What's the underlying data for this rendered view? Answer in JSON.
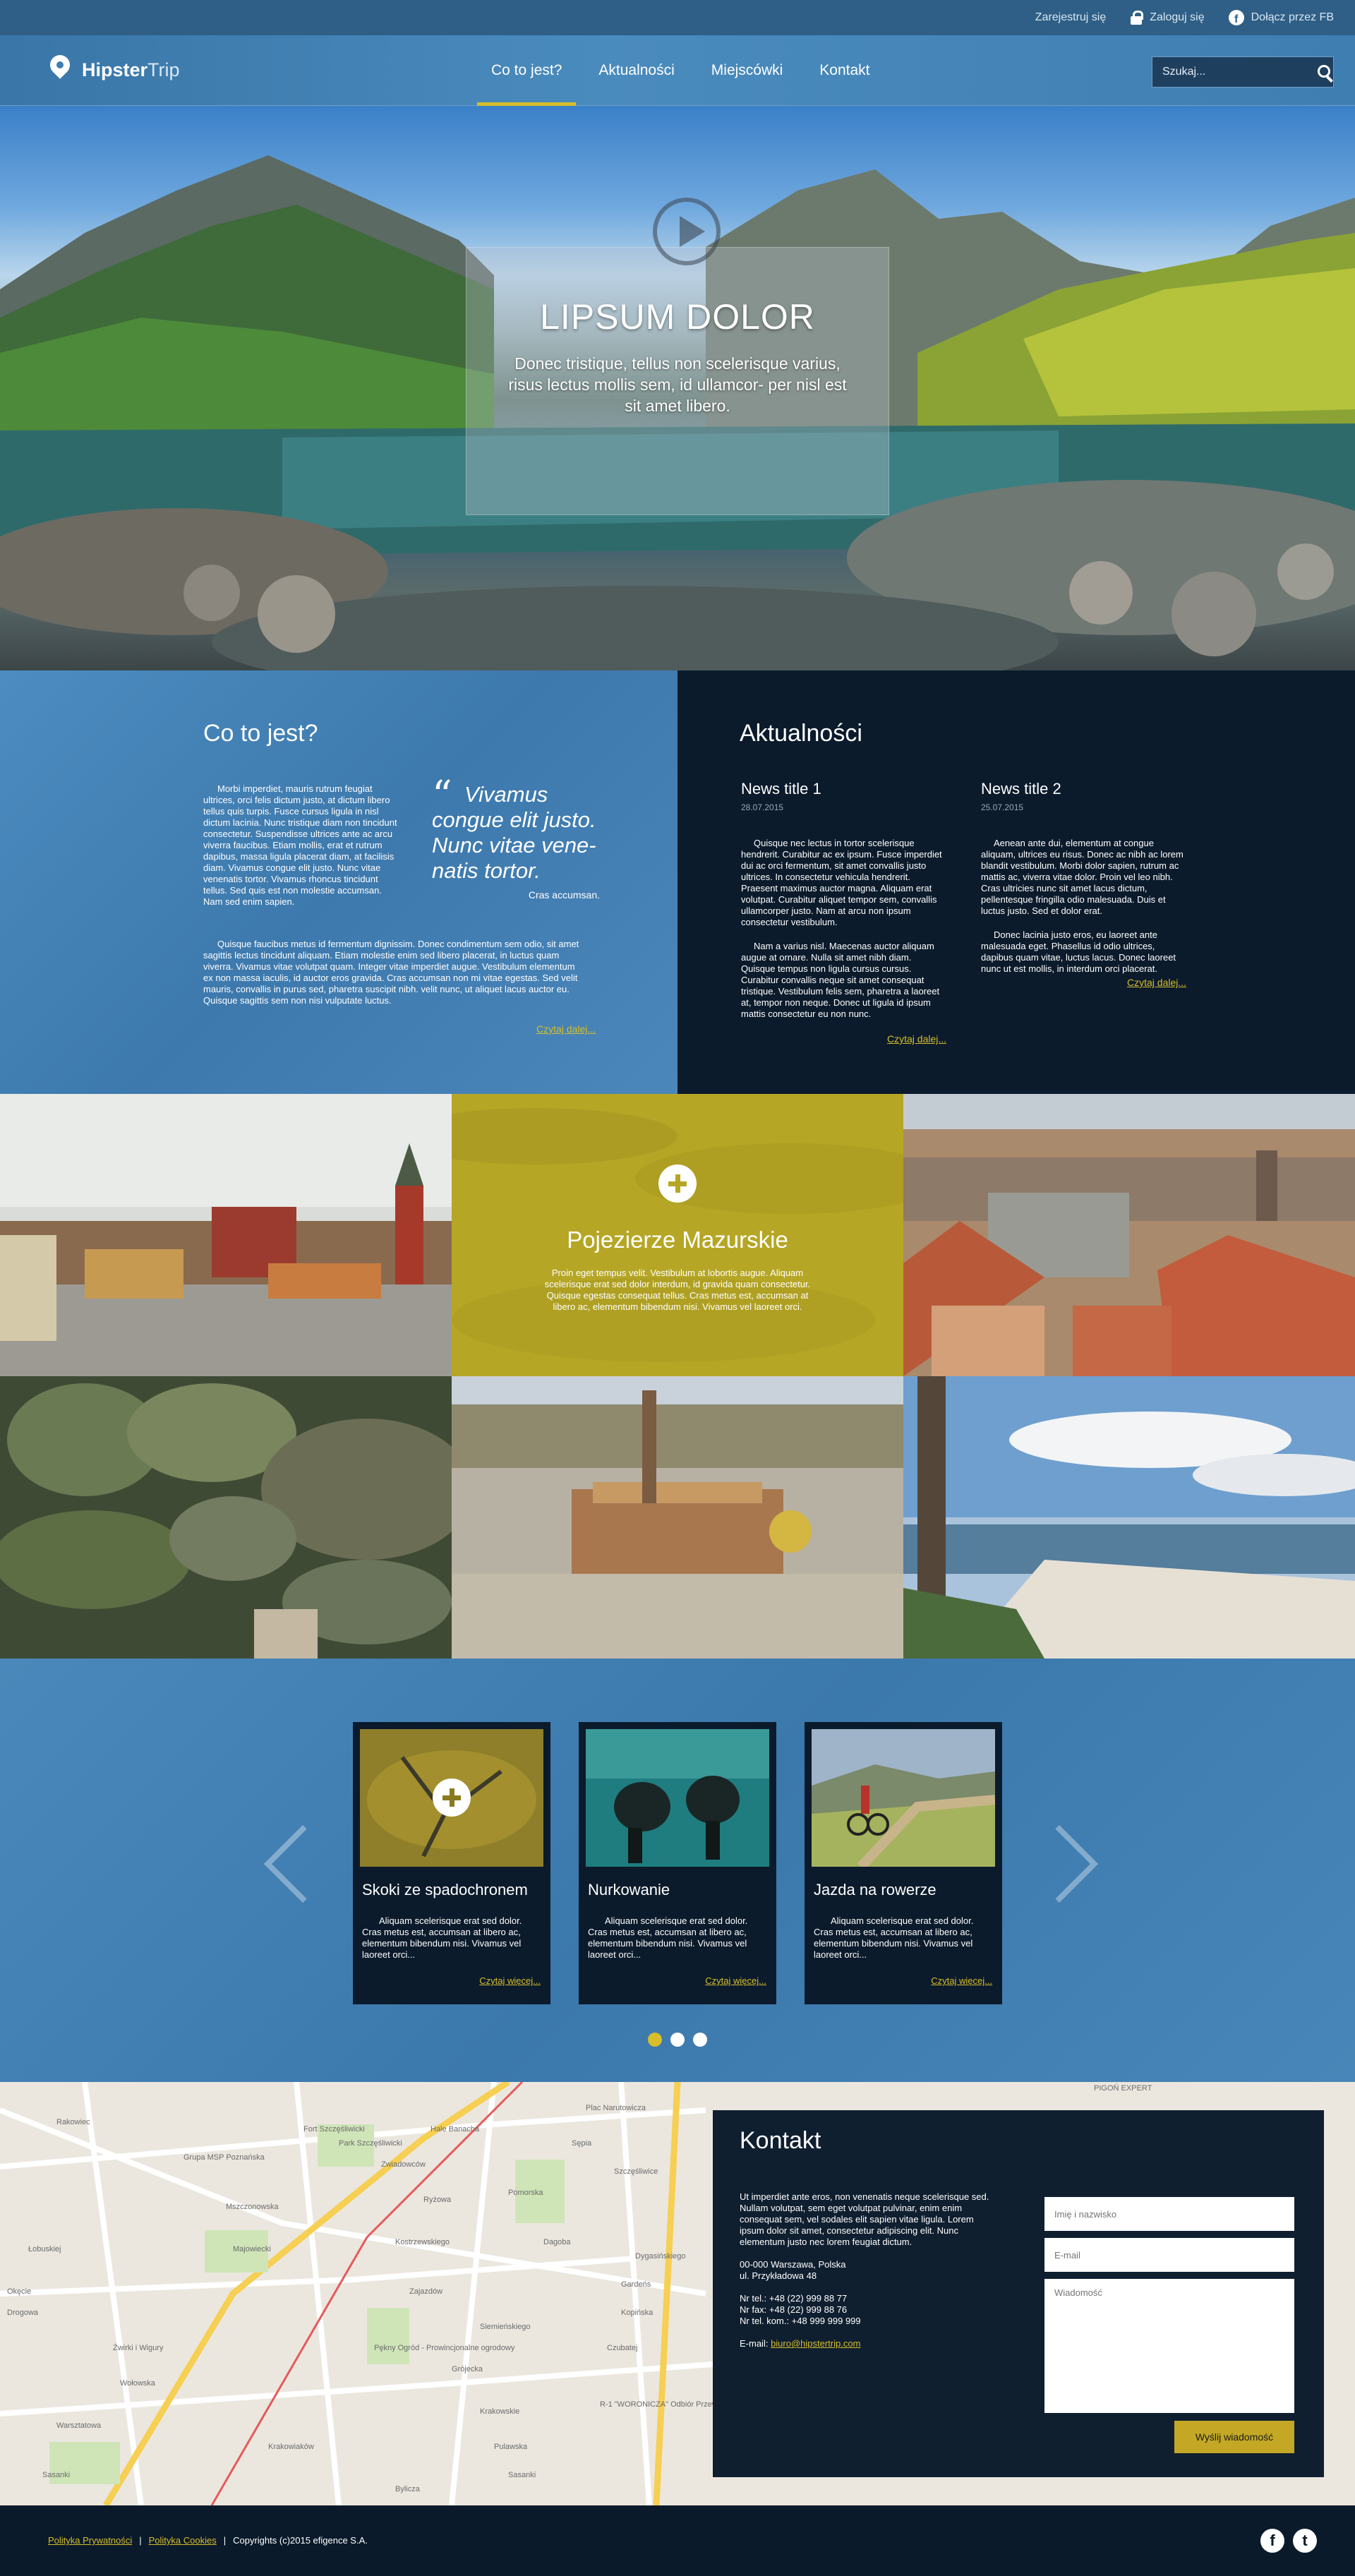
{
  "topbar": {
    "register": "Zarejestruj się",
    "login": "Zaloguj się",
    "facebook": "Dołącz przez FB",
    "login_icon": "lock-icon",
    "facebook_icon": "facebook-icon"
  },
  "header": {
    "logo_bold": "Hipster",
    "logo_light": "Trip",
    "nav": [
      "Co to jest?",
      "Aktualności",
      "Miejscówki",
      "Kontakt"
    ],
    "active_nav": "Co to jest?",
    "search_placeholder": "Szukaj..."
  },
  "hero": {
    "title": "LIPSUM DOLOR",
    "subtitle": "Donec tristique, tellus non scelerisque varius, risus lectus mollis sem, id ullamcor- per nisl est sit amet libero."
  },
  "about": {
    "title": "Co to jest?",
    "paragraph1": "Morbi imperdiet, mauris rutrum feugiat ultrices, orci felis dictum justo, at dictum libero tellus quis turpis. Fusce cursus ligula in nisl dictum lacinia. Nunc tristique diam non tincidunt consectetur. Suspendisse ultrices ante ac arcu viverra faucibus. Etiam mollis, erat et rutrum dapibus, massa ligula placerat diam, at facilisis diam. Vivamus congue elit justo. Nunc vitae venenatis tortor. Vivamus rhoncus tincidunt tellus. Sed quis est non molestie accumsan. Nam sed enim sapien.",
    "paragraph2": "Quisque faucibus metus id fermentum dignissim. Donec condimentum sem odio, sit amet sagittis lectus tincidunt aliquam. Etiam molestie enim sed libero placerat, in luctus quam viverra. Vivamus vitae volutpat quam. Integer vitae imperdiet augue. Vestibulum elementum ex non massa iaculis, id auctor eros gravida. Cras accumsan non mi vitae egestas. Sed velit mauris, convallis in purus sed, pharetra suscipit nibh. velit nunc, ut aliquet lacus auctor eu. Quisque sagittis sem non nisi vulputate luctus.",
    "quote": "Vivamus congue elit justo. Nunc vitae vene- natis tortor.",
    "quote_author": "Cras accumsan.",
    "more": "Czytaj dalej..."
  },
  "news": {
    "title": "Aktualności",
    "items": [
      {
        "title": "News title 1",
        "date": "28.07.2015",
        "text1": "Quisque nec lectus in tortor scelerisque hendrerit. Curabitur ac ex ipsum. Fusce imperdiet dui ac orci fermentum, sit amet convallis justo ultrices. In consectetur vehicula hendrerit. Praesent maximus auctor magna. Aliquam erat volutpat. Curabitur aliquet tempor sem, convallis ullamcorper justo. Nam at arcu non ipsum consectetur vestibulum.",
        "text2": "Nam a varius nisl. Maecenas auctor aliquam augue at ornare. Nulla sit amet nibh diam. Quisque tempus non ligula cursus cursus. Curabitur convallis neque sit amet consequat tristique. Vestibulum felis sem, pharetra a laoreet at, tempor non neque. Donec ut ligula id ipsum mattis consectetur eu non nunc.",
        "more": "Czytaj dalej..."
      },
      {
        "title": "News title 2",
        "date": "25.07.2015",
        "text1": "Aenean ante dui, elementum at congue aliquam, ultrices eu risus. Donec ac nibh ac lorem blandit vestibulum. Morbi dolor sapien, rutrum ac mattis ac, viverra vitae dolor. Proin vel leo nibh. Cras ultricies nunc sit amet lacus dictum, pellentesque fringilla odio malesuada. Duis et luctus justo. Sed et dolor erat.",
        "text2": "Donec lacinia justo eros, eu laoreet ante malesuada eget. Phasellus id odio ultrices, dapibus quam vitae, luctus lacus. Donec laoreet nunc ut est mollis, in interdum orci placerat.",
        "more": "Czytaj dalej..."
      }
    ]
  },
  "gallery": {
    "featured_title": "Pojezierze Mazurskie",
    "featured_text": "Proin eget tempus velit. Vestibulum at lobortis augue. Aliquam scelerisque erat sed dolor interdum, id gravida quam consectetur. Quisque egestas consequat tellus. Cras metus est, accumsan at libero ac, elementum bibendum nisi. Vivamus vel laoreet orci.",
    "featured_icon": "plus-icon",
    "featured_color": "#b6a625"
  },
  "activities": {
    "cards": [
      {
        "title": "Skoki ze spadochronem",
        "text": "Aliquam scelerisque erat sed dolor. Cras metus est, accumsan at libero ac, elementum bibendum nisi. Vivamus vel laoreet orci...",
        "more": "Czytaj więcej..."
      },
      {
        "title": "Nurkowanie",
        "text": "Aliquam scelerisque erat sed dolor. Cras metus est, accumsan at libero ac, elementum bibendum nisi. Vivamus vel laoreet orci...",
        "more": "Czytaj więcej..."
      },
      {
        "title": "Jazda na rowerze",
        "text": "Aliquam scelerisque erat sed dolor. Cras metus est, accumsan at libero ac, elementum bibendum nisi. Vivamus vel laoreet orci...",
        "more": "Czytaj więcej..."
      }
    ],
    "active_slide": 1,
    "slide_count": 3
  },
  "map": {
    "labels": [
      "Hale Banacha",
      "Mszczonowska",
      "Grupa MSP Poznańska",
      "Fort Szczęśliwicki",
      "Zwiadowców",
      "Sępia",
      "Szczęśliwice",
      "Krakowiaków",
      "Park Szczęśliwicki",
      "Majowiecki",
      "Kostrzewskiego",
      "Drogowa",
      "Okęcie",
      "Siemieńskiego",
      "Dagoba",
      "Kopińska",
      "Gardeńs",
      "Zajazdów",
      "Grójecka",
      "Plac Narutowicza",
      "Pomorska",
      "Łobuskiej",
      "Dygasińskiego",
      "Wołowska",
      "Czubatej",
      "Krakowskie",
      "Żwirki i Wigury",
      "PIGOŃ EXPERT",
      "Warsztatowa",
      "Pulawska",
      "Sasanki",
      "Rakowiec",
      "Pękny Ogród - Prowincjonalne ogrodowy",
      "R-1 \"WORONICZA\" Odbiór Przewozów",
      "Bylicza",
      "Sasanki",
      "Ryżowa"
    ]
  },
  "contact": {
    "title": "Kontakt",
    "intro": "Ut imperdiet ante eros, non venenatis neque scelerisque sed. Nullam volutpat, sem eget volutpat pulvinar, enim enim consequat sem, vel sodales elit sapien vitae ligula. Lorem ipsum dolor sit amet, consectetur adipiscing elit. Nunc elementum justo nec lorem feugiat dictum.",
    "address1": "00-000 Warszawa, Polska",
    "address2": "ul. Przykładowa 48",
    "tel": "Nr tel.: +48 (22) 999 88 77",
    "fax": "Nr fax: +48 (22) 999 88 76",
    "mobile": "Nr tel. kom.: +48 999 999 999",
    "email_label": "E-mail: ",
    "email": "biuro@hipstertrip.com",
    "name_placeholder": "Imię i nazwisko",
    "email_placeholder": "E-mail",
    "message_placeholder": "Wiadomość",
    "send": "Wyślij wiadomość"
  },
  "footer": {
    "privacy": "Polityka Prywatności",
    "cookies": "Polityka Cookies",
    "sep": "|",
    "copyright": "Copyrights (c)2015 efigence S.A.",
    "social_icons": [
      "facebook-icon",
      "twitter-icon"
    ]
  },
  "colors": {
    "accent": "#d7be2a",
    "primary_blue": "#3f7eb1",
    "dark_navy": "#0b1b2c"
  }
}
